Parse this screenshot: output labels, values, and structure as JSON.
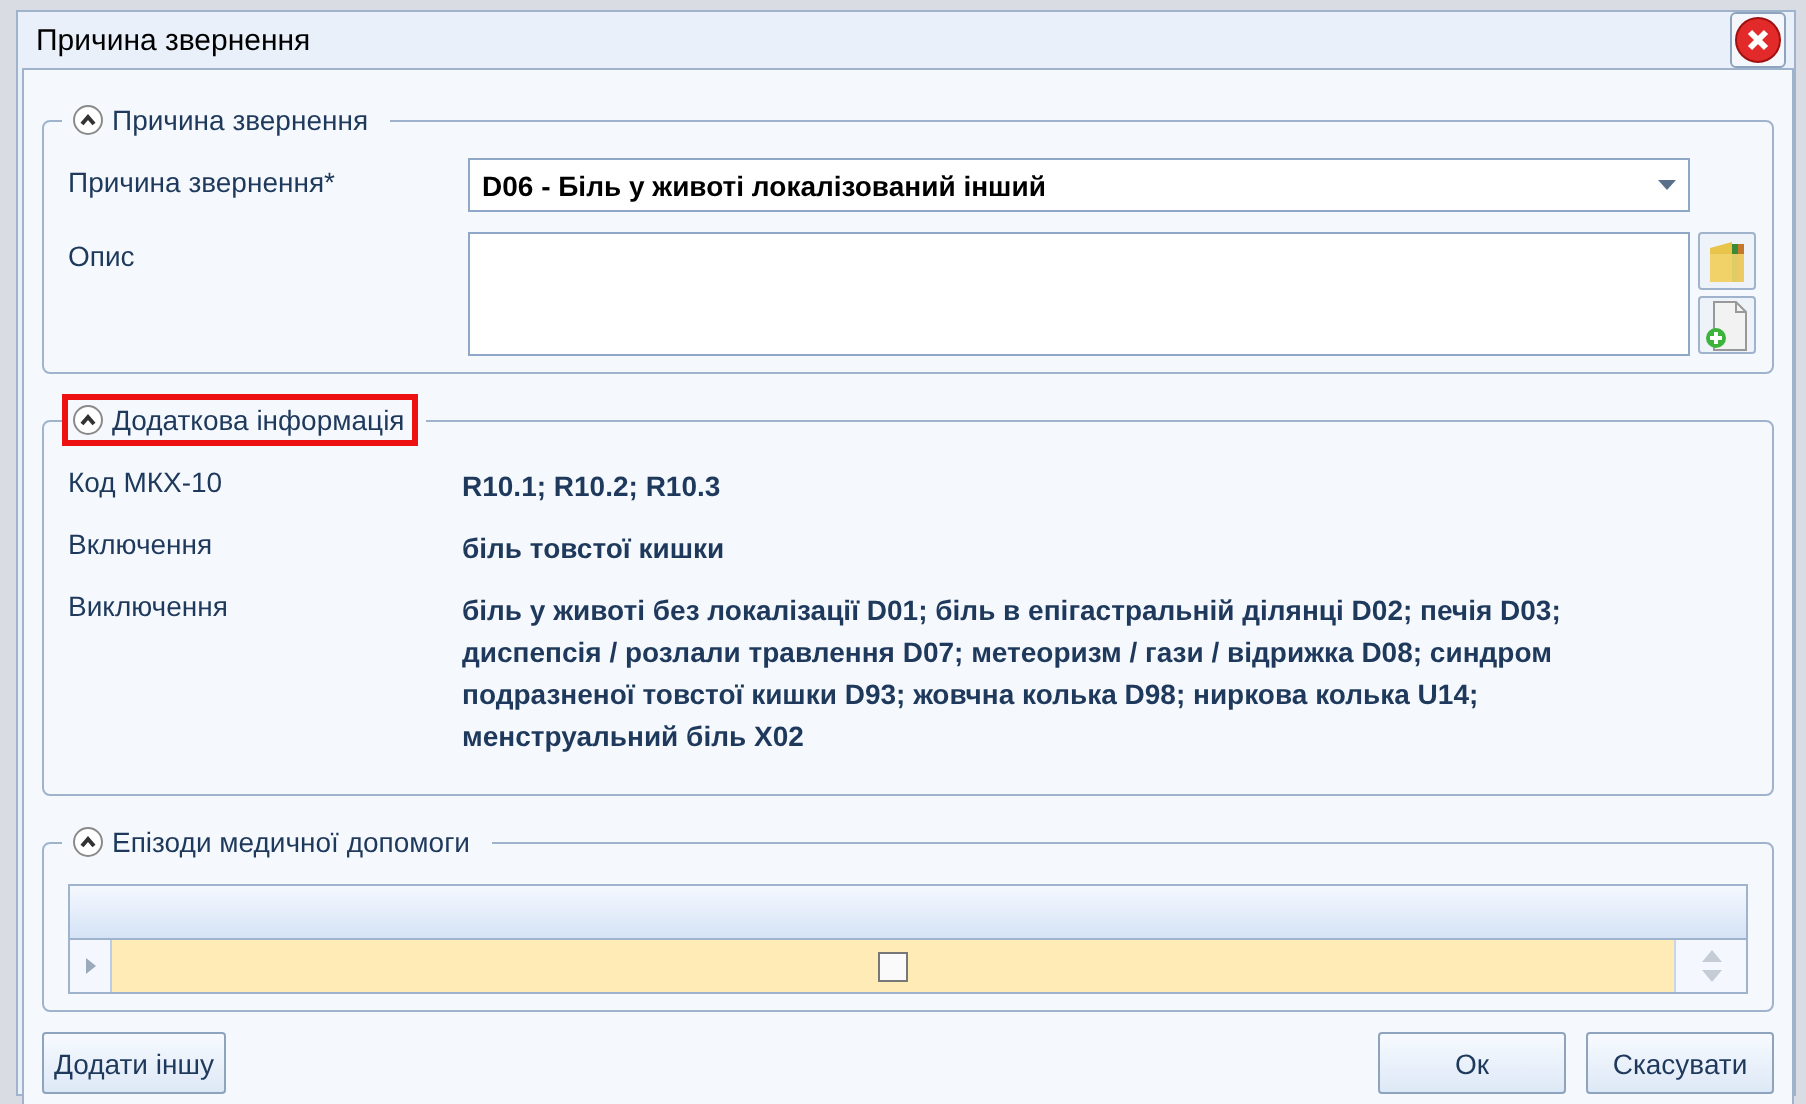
{
  "window": {
    "title": "Причина звернення"
  },
  "sections": [
    {
      "kind": "form",
      "title": "Причина звернення",
      "expanded": true,
      "highlighted": false,
      "reason_label": "Причина звернення*",
      "reason_value": "D06 - Біль у животі локалізований інший",
      "description_label": "Опис"
    },
    {
      "kind": "info",
      "title": "Додаткова інформація",
      "expanded": true,
      "highlighted": true,
      "rows": [
        {
          "label": "Код МКХ-10",
          "value": "R10.1; R10.2; R10.3"
        },
        {
          "label": "Включення",
          "value": "біль товстої кишки"
        },
        {
          "label": "Виключення",
          "value": "біль у животі без локалізації D01; біль в епігастральній ділянці D02; печія D03; диспепсія / розлали травлення D07; метеоризм / гази / відрижка D08; синдром подразненої товстої кишки D93; жовчна колька D98; ниркова колька U14; менструальний біль X02"
        }
      ]
    },
    {
      "kind": "grid",
      "title": "Епізоди медичної допомоги",
      "expanded": true,
      "highlighted": false,
      "rows": [
        {
          "checked": false,
          "selected": true
        }
      ]
    }
  ],
  "buttons": {
    "left": "Додати іншу",
    "ok": "Ок",
    "cancel": "Скасувати"
  }
}
